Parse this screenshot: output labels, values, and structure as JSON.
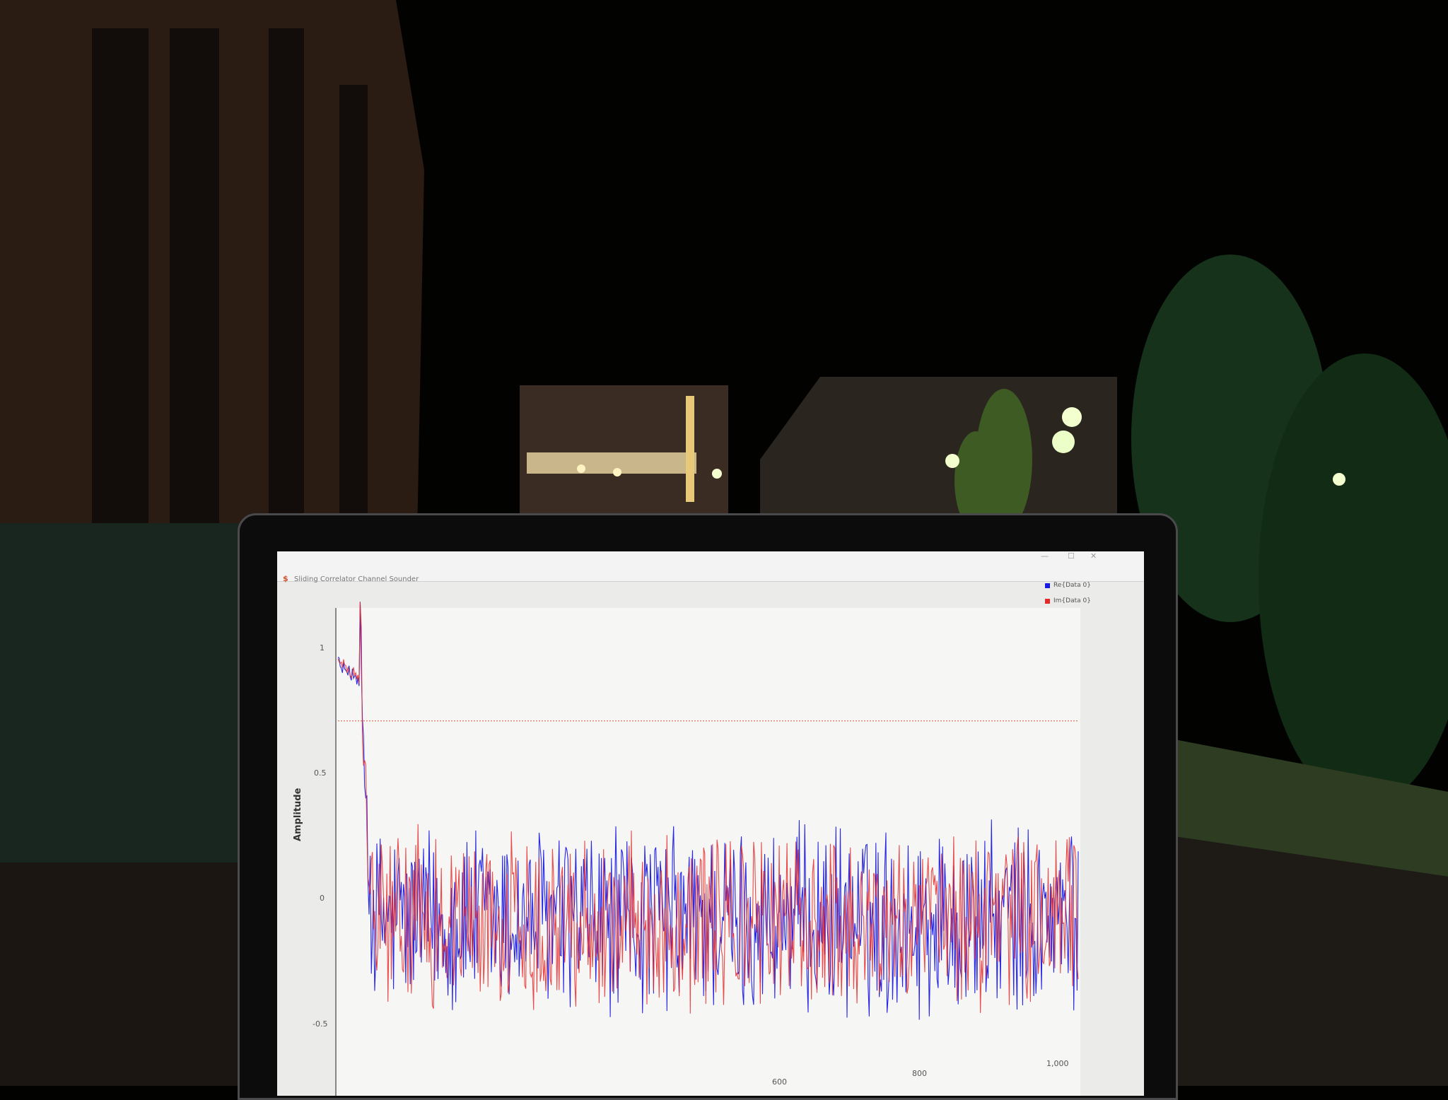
{
  "window": {
    "title": "Sliding Correlator Channel Sounder",
    "app_icon": "app-logo-icon",
    "controls": [
      "—",
      "☐",
      "✕"
    ]
  },
  "legend": [
    {
      "label": "Re{Data 0}",
      "color": "#1a1ae6"
    },
    {
      "label": "Im{Data 0}",
      "color": "#e62a2a"
    }
  ],
  "colors": {
    "real": "#1a1ae6",
    "imag": "#e62a2a",
    "threshold": "#d45a40"
  },
  "chart_data": {
    "type": "line",
    "ylabel": "Amplitude",
    "xlabel": "",
    "yticks": [
      "1",
      "0.5",
      "0",
      "-0.5"
    ],
    "xticks": [
      "600",
      "800",
      "1,000"
    ],
    "ylim": [
      -0.6,
      1.1
    ],
    "xlim": [
      0,
      1000
    ],
    "threshold": 0.72,
    "series": [
      {
        "name": "Re{Data 0}",
        "peak": 0.95,
        "peak_end_x": 30,
        "noise_amplitude": 0.3
      },
      {
        "name": "Im{Data 0}",
        "peak": 0.96,
        "peak_end_x": 30,
        "noise_amplitude": 0.28
      }
    ]
  }
}
